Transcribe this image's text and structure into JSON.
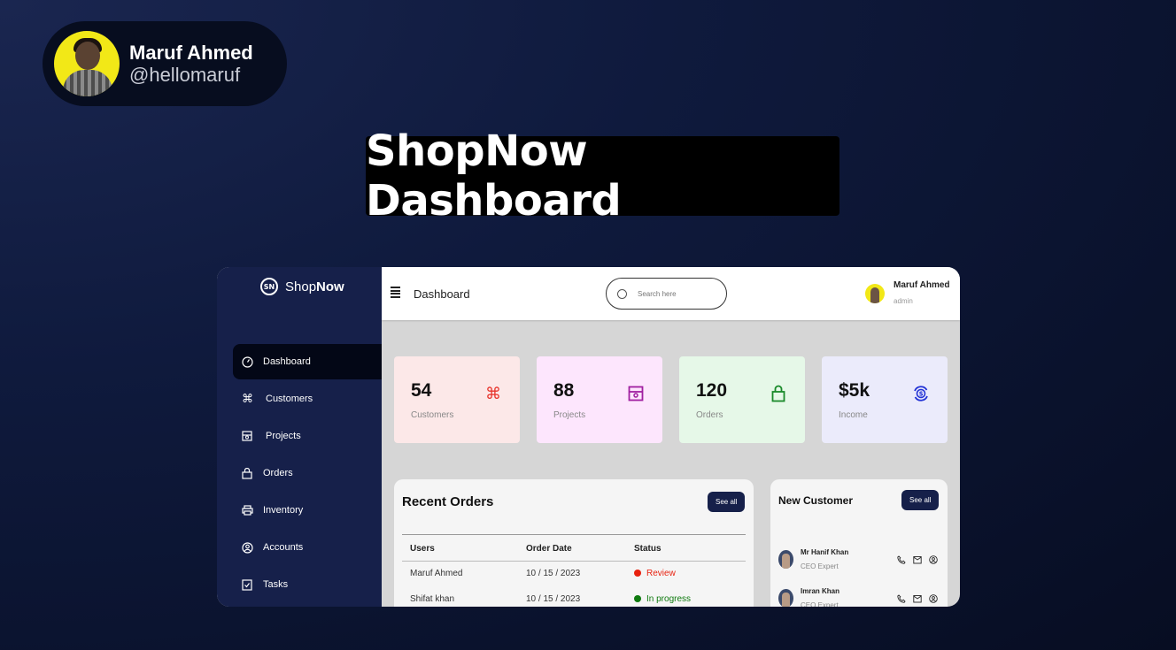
{
  "author": {
    "name": "Maruf Ahmed",
    "handle": "@hellomaruf"
  },
  "headline": "ShopNow Dashboard",
  "brand": {
    "prefix": "Shop",
    "suffix": "Now",
    "logo_text": "SN"
  },
  "sidebar": {
    "items": [
      {
        "label": "Dashboard",
        "icon": "gauge-icon",
        "active": true
      },
      {
        "label": "Customers",
        "icon": "command-icon"
      },
      {
        "label": "Projects",
        "icon": "project-icon"
      },
      {
        "label": "Orders",
        "icon": "bag-icon"
      },
      {
        "label": "Inventory",
        "icon": "printer-icon"
      },
      {
        "label": "Accounts",
        "icon": "user-circle-icon"
      },
      {
        "label": "Tasks",
        "icon": "checkbox-icon"
      }
    ]
  },
  "topbar": {
    "title": "Dashboard",
    "search_placeholder": "Search here",
    "user_name": "Maruf Ahmed",
    "user_role": "admin"
  },
  "stats": [
    {
      "value": "54",
      "label": "Customers",
      "icon": "command-icon",
      "color": "#e8322a",
      "bg": "#fce8e8"
    },
    {
      "value": "88",
      "label": "Projects",
      "icon": "project-icon",
      "color": "#a020a0",
      "bg": "#fde6fd"
    },
    {
      "value": "120",
      "label": "Orders",
      "icon": "bag-icon",
      "color": "#1a8a2a",
      "bg": "#e6f8e8"
    },
    {
      "value": "$5k",
      "label": "Income",
      "icon": "dollar-cycle-icon",
      "color": "#2434d6",
      "bg": "#ebebfb"
    }
  ],
  "recent_orders": {
    "title": "Recent Orders",
    "see_all": "See all",
    "columns": [
      "Users",
      "Order Date",
      "Status"
    ],
    "rows": [
      {
        "user": "Maruf Ahmed",
        "date": "10 / 15 / 2023",
        "status": "Review",
        "status_color": "#e8210f"
      },
      {
        "user": "Shifat khan",
        "date": "10 / 15 / 2023",
        "status": "In progress",
        "status_color": "#0f7a0f"
      }
    ]
  },
  "new_customer": {
    "title": "New Customer",
    "see_all": "See all",
    "customers": [
      {
        "name": "Mr Hanif Khan",
        "role": "CEO Expert"
      },
      {
        "name": "Imran Khan",
        "role": "CEO Expert"
      }
    ]
  }
}
